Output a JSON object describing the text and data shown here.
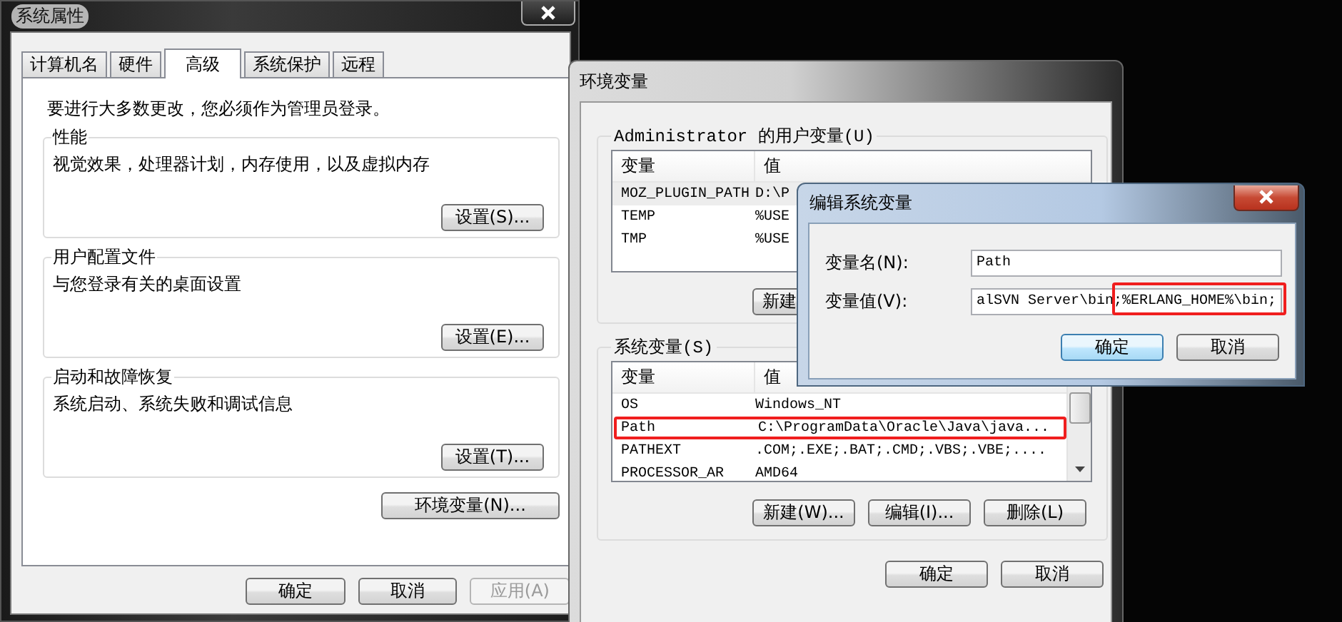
{
  "system_properties": {
    "title": "系统属性",
    "tabs": [
      {
        "label": "计算机名",
        "selected": false
      },
      {
        "label": "硬件",
        "selected": false
      },
      {
        "label": "高级",
        "selected": true
      },
      {
        "label": "系统保护",
        "selected": false
      },
      {
        "label": "远程",
        "selected": false
      }
    ],
    "notice": "要进行大多数更改，您必须作为管理员登录。",
    "groups": [
      {
        "title": "性能",
        "description": "视觉效果，处理器计划，内存使用，以及虚拟内存",
        "button": "设置(S)..."
      },
      {
        "title": "用户配置文件",
        "description": "与您登录有关的桌面设置",
        "button": "设置(E)..."
      },
      {
        "title": "启动和故障恢复",
        "description": "系统启动、系统失败和调试信息",
        "button": "设置(T)..."
      }
    ],
    "env_button": "环境变量(N)...",
    "buttons": [
      {
        "label": "确定",
        "disabled": false
      },
      {
        "label": "取消",
        "disabled": false
      },
      {
        "label": "应用(A)",
        "disabled": true
      }
    ]
  },
  "environment_variables": {
    "title": "环境变量",
    "user_group": {
      "title": "Administrator 的用户变量(U)",
      "columns": [
        "变量",
        "值"
      ],
      "rows": [
        {
          "name": "MOZ_PLUGIN_PATH",
          "value": "D:\\P",
          "selected": true
        },
        {
          "name": "TEMP",
          "value": "%USE",
          "selected": false
        },
        {
          "name": "TMP",
          "value": "%USE",
          "selected": false
        }
      ],
      "buttons": [
        "新建"
      ]
    },
    "system_group": {
      "title": "系统变量(S)",
      "columns": [
        "变量",
        "值"
      ],
      "rows": [
        {
          "name": "OS",
          "value": "Windows_NT",
          "highlighted": false
        },
        {
          "name": "Path",
          "value": "C:\\ProgramData\\Oracle\\Java\\java...",
          "highlighted": true
        },
        {
          "name": "PATHEXT",
          "value": ".COM;.EXE;.BAT;.CMD;.VBS;.VBE;....",
          "highlighted": false
        },
        {
          "name": "PROCESSOR_AR",
          "value": "AMD64",
          "highlighted": false
        }
      ],
      "buttons": [
        "新建(W)...",
        "编辑(I)...",
        "删除(L)"
      ]
    },
    "buttons": [
      "确定",
      "取消"
    ]
  },
  "edit_dialog": {
    "title": "编辑系统变量",
    "fields": [
      {
        "label": "变量名(N):",
        "value": "Path",
        "highlighted": false
      },
      {
        "label": "变量值(V):",
        "value": "alSVN Server\\bin;%ERLANG_HOME%\\bin;",
        "highlighted": true
      }
    ],
    "buttons": [
      {
        "label": "确定",
        "default": true
      },
      {
        "label": "取消",
        "default": false
      }
    ]
  }
}
